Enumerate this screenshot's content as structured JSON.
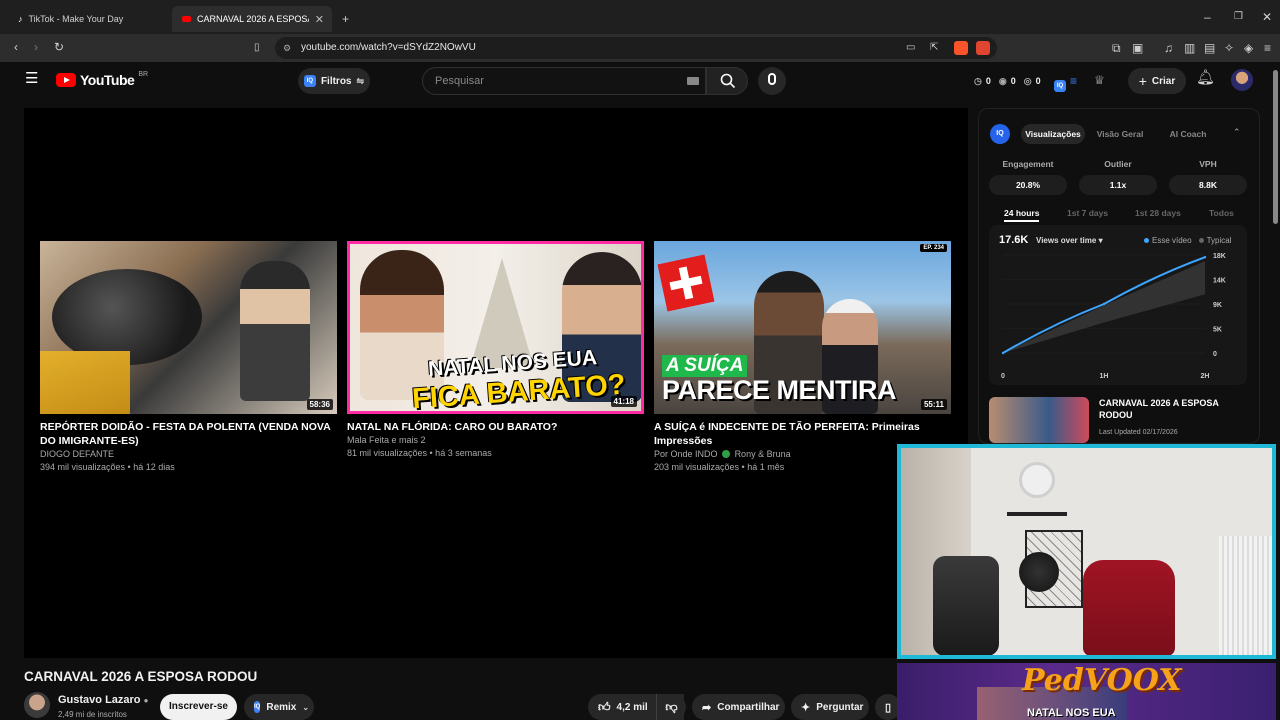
{
  "browser": {
    "tabs": [
      {
        "label": "TikTok - Make Your Day",
        "active": false
      },
      {
        "label": "CARNAVAL 2026 A ESPOSA RODOU",
        "active": true
      }
    ],
    "url": "youtube.com/watch?v=dSYdZ2NOwVU"
  },
  "header": {
    "logo_text": "YouTube",
    "region": "BR",
    "filters_label": "Filtros",
    "search_placeholder": "Pesquisar",
    "counters": [
      "0",
      "0",
      "0"
    ],
    "create_label": "Criar"
  },
  "suggestions": [
    {
      "title": "REPÓRTER DOIDÃO - FESTA DA POLENTA (VENDA NOVA DO IMIGRANTE-ES)",
      "channel": "DIOGO DEFANTE",
      "stats": "394 mil visualizações • há 12 dias",
      "duration": "58:36"
    },
    {
      "title": "NATAL NA FLÓRIDA: CARO OU BARATO?",
      "channel": "Mala Feita e mais 2",
      "stats": "81 mil visualizações • há 3 semanas",
      "duration": "41:18",
      "overlay1": "NATAL NOS EUA",
      "overlay2": "FICA BARATO?"
    },
    {
      "title": "A SUÍÇA é INDECENTE DE TÃO PERFEITA: Primeiras Impressões",
      "channel": "Por Onde INDO",
      "channel2": "Rony & Bruna",
      "stats": "203 mil visualizações • há 1 mês",
      "duration": "55:11",
      "overlay1": "A SUÍÇA",
      "overlay2": "PARECE MENTIRA",
      "ep": "EP. 234"
    }
  ],
  "video": {
    "title": "CARNAVAL 2026 A ESPOSA RODOU",
    "channel": "Gustavo Lazaro",
    "subscribers": "2,49 mi de inscritos",
    "subscribe_label": "Inscrever-se",
    "remix_label": "Remix",
    "likes": "4,2 mil",
    "share_label": "Compartilhar",
    "ask_label": "Perguntar"
  },
  "iq_panel": {
    "tabs": [
      "Visualizações",
      "Visão Geral",
      "AI Coach"
    ],
    "metrics": [
      {
        "label": "Engagement",
        "value": "20.8%"
      },
      {
        "label": "Outlier",
        "value": "1.1x"
      },
      {
        "label": "VPH",
        "value": "8.8K"
      }
    ],
    "ranges": [
      "24 hours",
      "1st 7 days",
      "1st 28 days",
      "Todos"
    ],
    "total_views": "17.6K",
    "views_dropdown": "Views over time",
    "legend": [
      "Esse vídeo",
      "Typical"
    ],
    "related_title": "CARNAVAL 2026 A ESPOSA RODOU",
    "last_updated": "Last Updated 02/17/2026"
  },
  "chart_data": {
    "type": "area",
    "x": [
      "0",
      "1H",
      "2H"
    ],
    "y_ticks": [
      "0",
      "5K",
      "9K",
      "14K",
      "18K"
    ],
    "ylim": [
      0,
      18000
    ],
    "series": [
      {
        "name": "Esse vídeo",
        "color": "#3ea6ff",
        "values": [
          0,
          9000,
          17600
        ]
      },
      {
        "name": "Typical",
        "color": "#5a5a5a",
        "values": [
          0,
          7000,
          13500
        ]
      }
    ]
  },
  "overlay": {
    "banner_text": "PedVOOX",
    "partial_text": "NATAL NOS EUA"
  },
  "colors": {
    "accent": "#3ea6ff",
    "webcam_border": "#1fb8d6",
    "yt_red": "#ff0000"
  }
}
